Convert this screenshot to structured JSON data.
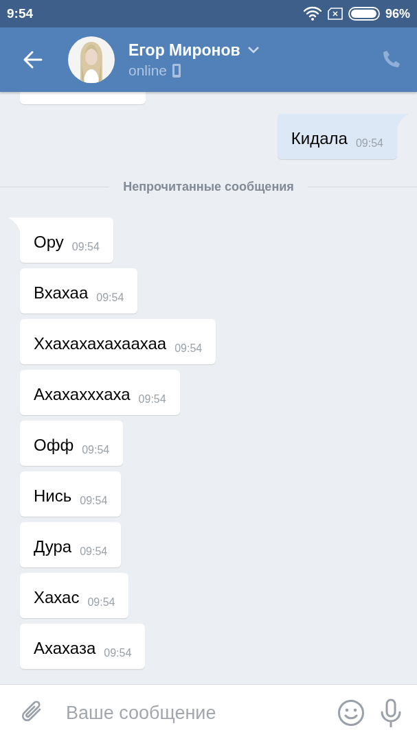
{
  "status_bar": {
    "time": "9:54",
    "battery": "96%"
  },
  "header": {
    "contact_name": "Егор Миронов",
    "status": "online"
  },
  "messages": [
    {
      "kind": "partial"
    },
    {
      "kind": "out",
      "text": "Кидала",
      "time": "09:54"
    },
    {
      "kind": "divider",
      "text": "Непрочитанные сообщения"
    },
    {
      "kind": "in",
      "text": "Ору",
      "time": "09:54"
    },
    {
      "kind": "in",
      "text": "Вхахаа",
      "time": "09:54"
    },
    {
      "kind": "in",
      "text": "Ххахахахахаахаа",
      "time": "09:54"
    },
    {
      "kind": "in",
      "text": "Ахахаххxаха",
      "time": "09:54"
    },
    {
      "kind": "in",
      "text": "Офф",
      "time": "09:54"
    },
    {
      "kind": "in",
      "text": "Нись",
      "time": "09:54"
    },
    {
      "kind": "in",
      "text": "Дура",
      "time": "09:54"
    },
    {
      "kind": "in",
      "text": "Хахас",
      "time": "09:54"
    },
    {
      "kind": "in",
      "text": "Ахахаза",
      "time": "09:54"
    }
  ],
  "composer": {
    "placeholder": "Ваше сообщение"
  }
}
